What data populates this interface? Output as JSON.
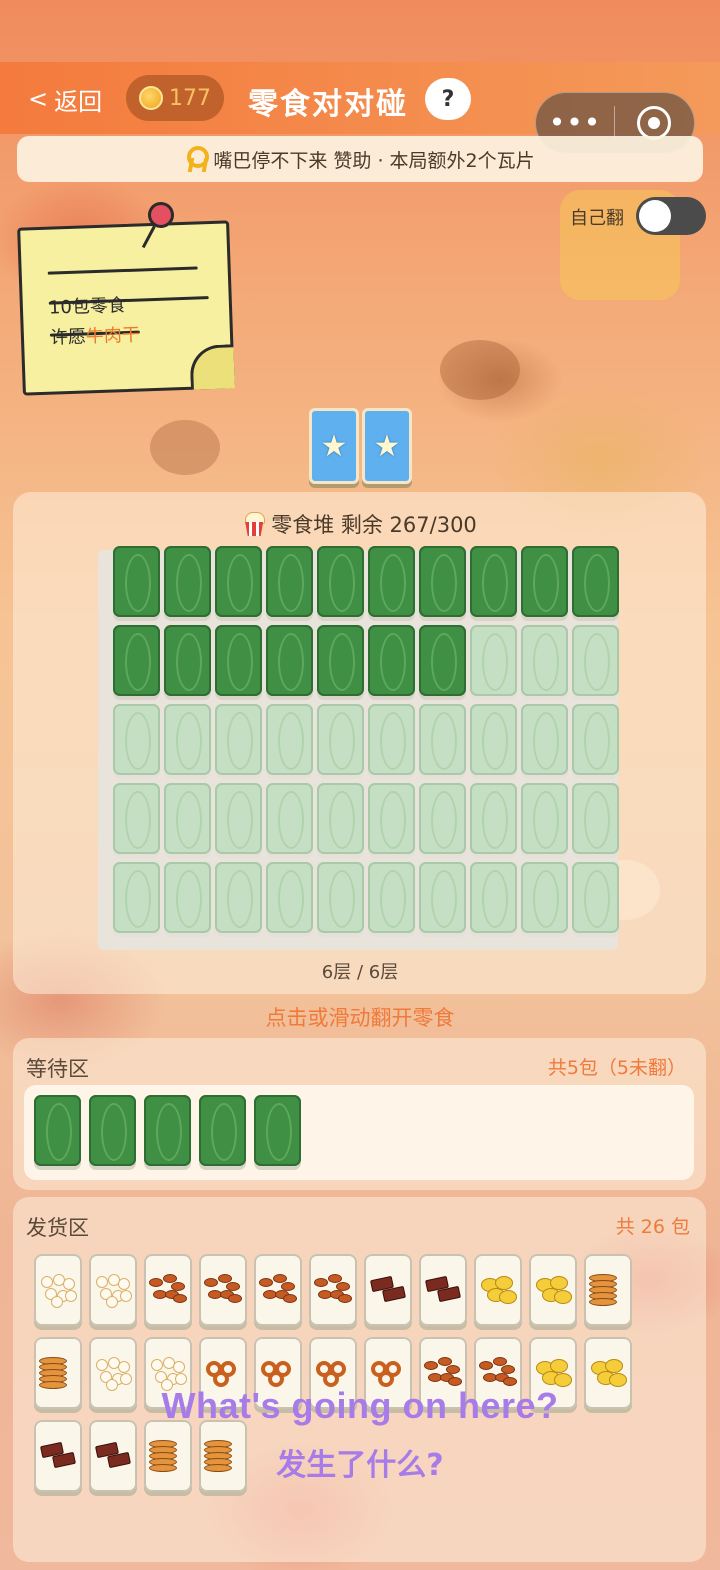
{
  "header": {
    "back_label": "返回",
    "back_arrow": "<",
    "coins": "177",
    "title": "零食对对碰",
    "help_label": "?"
  },
  "sponsor": {
    "text": "嘴巴停不下来 赞助 · 本局额外2个瓦片"
  },
  "toggle": {
    "label": "自己翻",
    "on": false
  },
  "note": {
    "line1": "10包零食",
    "line2_prefix": "许愿",
    "line2_highlight": "牛肉干"
  },
  "star_slots": {
    "count": 2,
    "glyph": "★"
  },
  "pile": {
    "title": "零食堆 剩余 267/300",
    "layers": "6层 / 6层",
    "columns": 10,
    "rows": 5,
    "active_tiles": 17
  },
  "hint": "点击或滑动翻开零食",
  "waiting": {
    "label": "等待区",
    "count": "共5包（5未翻）",
    "tiles": 5
  },
  "shipping": {
    "label": "发货区",
    "count": "共 26 包",
    "items": [
      "popcorn",
      "popcorn",
      "almond",
      "almond",
      "almond",
      "almond",
      "jerky",
      "jerky",
      "chips",
      "chips",
      "cookie",
      "cookie",
      "popcorn",
      "popcorn",
      "pretzel",
      "pretzel",
      "pretzel",
      "pretzel",
      "almond",
      "almond",
      "chips",
      "chips",
      "jerky",
      "jerky",
      "cookie",
      "cookie"
    ]
  },
  "subtitle": {
    "en": "What's going on here?",
    "zh": "发生了什么?"
  },
  "colors": {
    "accent": "#ef7a3a",
    "tile_green": "#3f8f45",
    "tile_faded": "#c5dfc4",
    "subtitle": "#a77be8"
  }
}
